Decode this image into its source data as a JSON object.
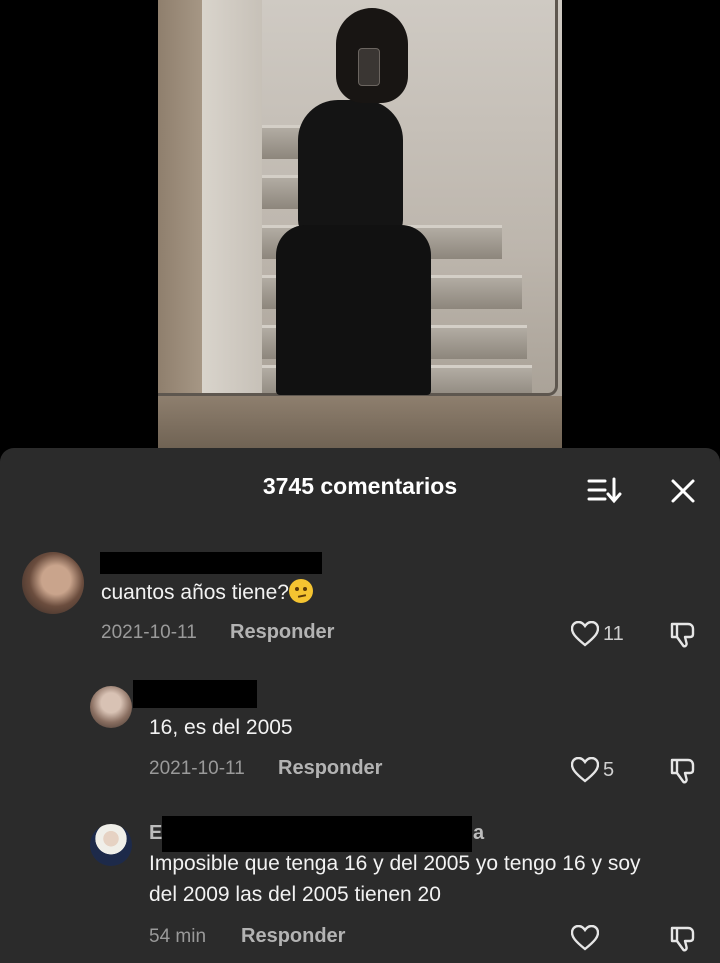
{
  "header": {
    "title": "3745 comentarios",
    "sort_icon": "sort-icon",
    "close_icon": "close-icon"
  },
  "comments": [
    {
      "text": "cuantos años tiene?",
      "emoji": "thinking-face",
      "date": "2021-10-11",
      "reply_label": "Responder",
      "likes": "11"
    },
    {
      "text": "16, es del 2005",
      "date": "2021-10-11",
      "reply_label": "Responder",
      "likes": "5"
    },
    {
      "username_start": "E",
      "username_end": "a",
      "text_line1": "Imposible que tenga 16 y del 2005 yo tengo 16 y soy",
      "text_line2": "del 2009 las del 2005 tienen 20",
      "date": "54 min",
      "reply_label": "Responder",
      "likes": ""
    }
  ],
  "colors": {
    "sheet_bg": "#2b2b2b",
    "text_primary": "#f2f2f2",
    "text_secondary": "#9a9a9a"
  }
}
